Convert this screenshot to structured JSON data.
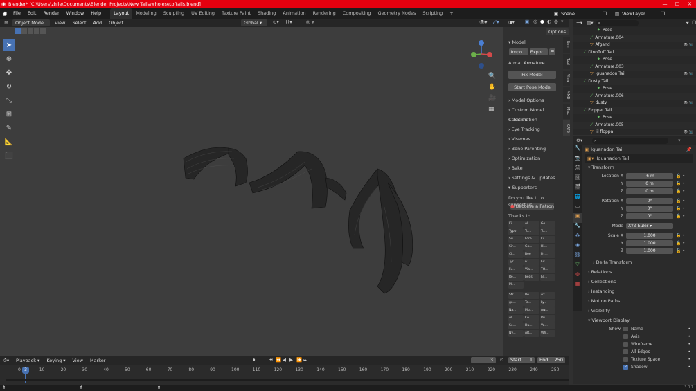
{
  "window": {
    "title": "Blender* [C:\\Users\\zhile\\Documents\\Blender Projects\\New Tails\\wholesetoftails.blend]"
  },
  "menu": [
    "File",
    "Edit",
    "Render",
    "Window",
    "Help"
  ],
  "workspaces": [
    "Layout",
    "Modeling",
    "Sculpting",
    "UV Editing",
    "Texture Paint",
    "Shading",
    "Animation",
    "Rendering",
    "Compositing",
    "Geometry Nodes",
    "Scripting"
  ],
  "scene": "Scene",
  "view_layer": "ViewLayer",
  "viewport_header": {
    "mode": "Object Mode",
    "view": "View",
    "select": "Select",
    "add": "Add",
    "object": "Object",
    "transform": "Global",
    "options": "Options"
  },
  "vtabs": [
    "Item",
    "Tool",
    "View",
    "MMD",
    "Misc",
    "CATS"
  ],
  "npanel": {
    "title": "Model",
    "import": "Impo...",
    "export": "Expor...",
    "armature_label": "Armat...",
    "armature_value": "Armature...",
    "fix_model": "Fix Model",
    "start_pose": "Start Pose Mode",
    "sections": [
      "Model Options",
      "Custom Model Creation",
      "Decimation",
      "Eye Tracking",
      "Visemes",
      "Bone Parenting",
      "Optimization",
      "Bake",
      "Settings & Updates",
      "Supporters"
    ],
    "support_text": "Do you like t...o support us",
    "patron": "Become a Patron",
    "thanks": "Thanks to ou...pporters! <3",
    "supporters": [
      "Ki...",
      "Al...",
      "Go...",
      "Typo",
      "Tu...",
      "Tu...",
      "Su...",
      "Lore...",
      "Ci...",
      "Sir...",
      "Go...",
      "Hi...",
      "Cl...",
      "Bee",
      "Fri...",
      "Tyr...",
      "n1...",
      "Ev...",
      "Fu...",
      "Via...",
      "TO...",
      "Re...",
      "beas",
      "Le...",
      "Mi..."
    ],
    "supporters2": [
      "Str...",
      "Be...",
      "Az...",
      "go...",
      "To...",
      "Ly...",
      "Na...",
      "Mu...",
      "Aw...",
      "Al...",
      "Co...",
      "Ru...",
      "Se...",
      "Hu...",
      "Va...",
      "Ny...",
      "AR...",
      "Wh..."
    ]
  },
  "outliner": [
    {
      "indent": 3,
      "icon": "pose",
      "name": "Pose",
      "color": "#6cc46c"
    },
    {
      "indent": 2,
      "icon": "armature",
      "name": "Armature.004",
      "color": "#6cc46c"
    },
    {
      "indent": 2,
      "icon": "mesh",
      "name": "Afgand",
      "color": "#e2a050"
    },
    {
      "indent": 1,
      "icon": "armature",
      "name": "Dinofluff Tail",
      "color": "#6cc46c"
    },
    {
      "indent": 3,
      "icon": "pose",
      "name": "Pose",
      "color": "#6cc46c"
    },
    {
      "indent": 2,
      "icon": "armature",
      "name": "Armature.003",
      "color": "#6cc46c"
    },
    {
      "indent": 2,
      "icon": "mesh",
      "name": "Iguanadon Tail",
      "color": "#e2a050"
    },
    {
      "indent": 1,
      "icon": "armature",
      "name": "Dusty Tail",
      "color": "#6cc46c"
    },
    {
      "indent": 3,
      "icon": "pose",
      "name": "Pose",
      "color": "#6cc46c"
    },
    {
      "indent": 2,
      "icon": "armature",
      "name": "Armature.006",
      "color": "#6cc46c"
    },
    {
      "indent": 2,
      "icon": "mesh",
      "name": "dusty",
      "color": "#e2a050"
    },
    {
      "indent": 1,
      "icon": "armature",
      "name": "Flopper Tail",
      "color": "#6cc46c"
    },
    {
      "indent": 3,
      "icon": "pose",
      "name": "Pose",
      "color": "#6cc46c"
    },
    {
      "indent": 2,
      "icon": "armature",
      "name": "Armature.005",
      "color": "#6cc46c"
    },
    {
      "indent": 2,
      "icon": "mesh",
      "name": "lil floppa",
      "color": "#e2a050"
    }
  ],
  "properties": {
    "object_name": "Iguanadon Tail",
    "data_name": "Iguanadon Tail",
    "transform_label": "Transform",
    "location": {
      "label": "Location X",
      "x": "-6 m",
      "y": "0 m",
      "z": "0 m"
    },
    "rotation": {
      "label": "Rotation X",
      "x": "0°",
      "y": "0°",
      "z": "0°"
    },
    "mode_label": "Mode",
    "mode": "XYZ Euler",
    "scale": {
      "label": "Scale X",
      "x": "1.000",
      "y": "1.000",
      "z": "1.000"
    },
    "y_label": "Y",
    "z_label": "Z",
    "sections": [
      "Delta Transform",
      "Relations",
      "Collections",
      "Instancing",
      "Motion Paths",
      "Visibility"
    ],
    "viewport_display": "Viewport Display",
    "show_label": "Show",
    "checks": [
      {
        "label": "Name",
        "checked": false
      },
      {
        "label": "Axis",
        "checked": false
      },
      {
        "label": "Wireframe",
        "checked": false
      },
      {
        "label": "All Edges",
        "checked": false
      },
      {
        "label": "Texture Space",
        "checked": false
      },
      {
        "label": "Shadow",
        "checked": true
      }
    ]
  },
  "timeline": {
    "playback": "Playback",
    "keying": "Keying",
    "view": "View",
    "marker": "Marker",
    "current_frame": "3",
    "start_label": "Start",
    "start": "1",
    "end_label": "End",
    "end": "250",
    "ticks": [
      "0",
      "10",
      "20",
      "30",
      "40",
      "50",
      "60",
      "70",
      "80",
      "90",
      "100",
      "110",
      "120",
      "130",
      "140",
      "150",
      "160",
      "170",
      "180",
      "190",
      "200",
      "210",
      "220",
      "230",
      "240",
      "250"
    ],
    "current_marker": "3"
  },
  "status": {
    "version": "3.0.1"
  }
}
